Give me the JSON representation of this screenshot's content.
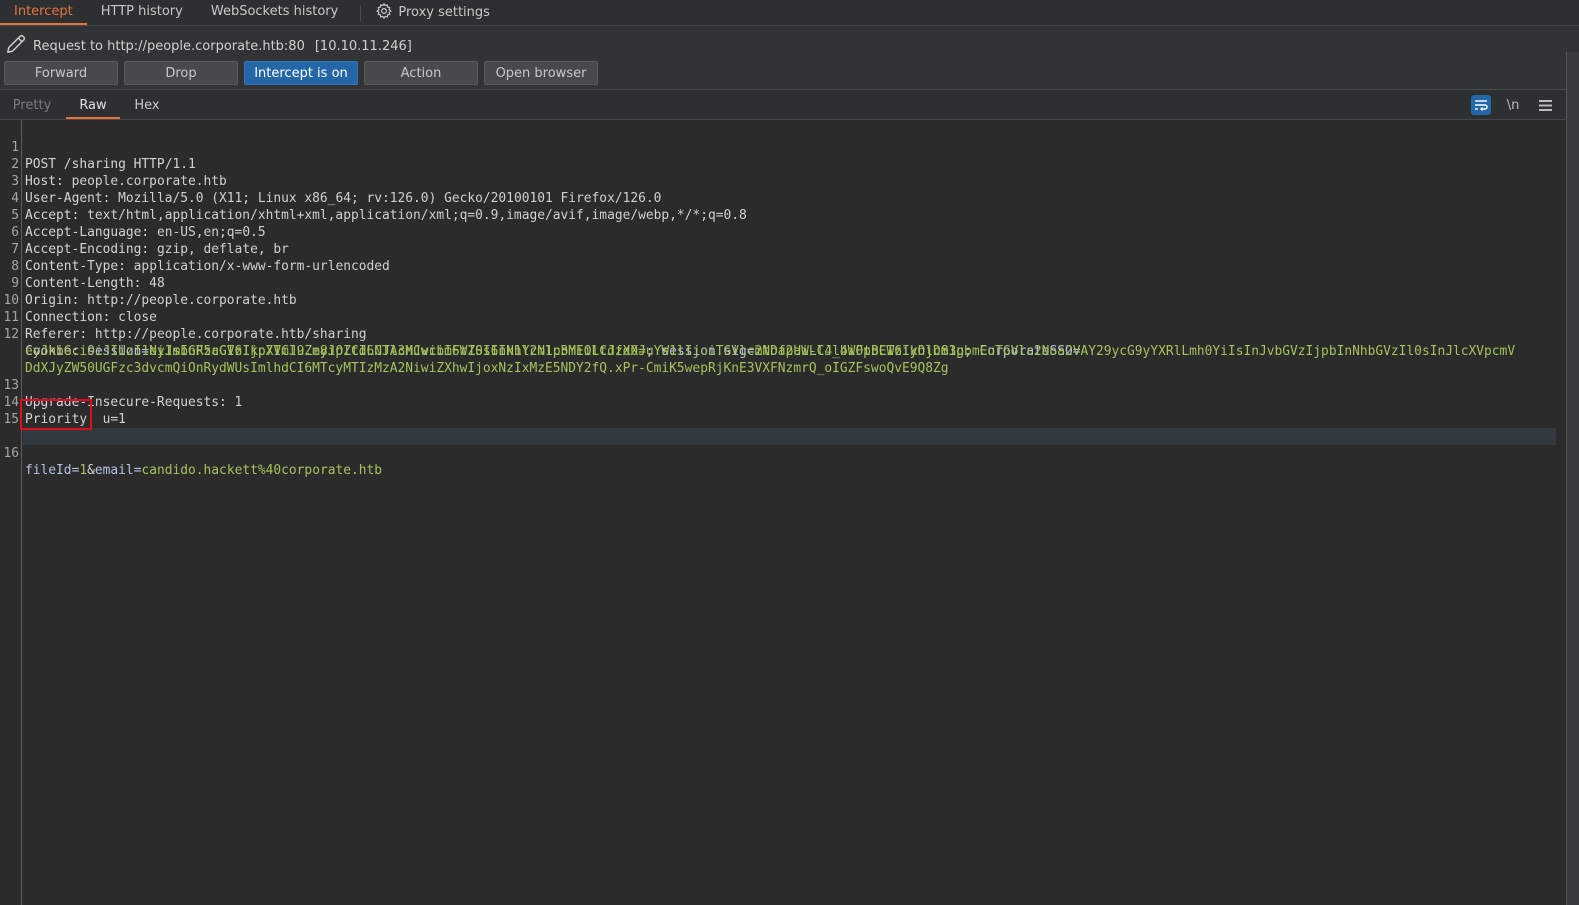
{
  "topnav": {
    "tabs": [
      {
        "label": "Intercept",
        "active": true
      },
      {
        "label": "HTTP history",
        "active": false
      },
      {
        "label": "WebSockets history",
        "active": false
      }
    ],
    "settings_label": "Proxy settings",
    "settings_icon": "gear-icon"
  },
  "request": {
    "icon": "pencil-icon",
    "label": "Request to http://people.corporate.htb:80",
    "ip": "[10.10.11.246]"
  },
  "buttons": {
    "forward": "Forward",
    "drop": "Drop",
    "intercept": "Intercept is on",
    "action": "Action",
    "open_browser": "Open browser"
  },
  "subtabs": {
    "pretty": "Pretty",
    "raw": "Raw",
    "hex": "Hex",
    "active": "Raw"
  },
  "tools": {
    "wrap_icon": "word-wrap-icon",
    "newline_label": "\\n",
    "menu_icon": "hamburger-menu-icon"
  },
  "lines": [
    {
      "n": "1",
      "text": "POST /sharing HTTP/1.1"
    },
    {
      "n": "2",
      "key": "Host:",
      "value": " people.corporate.htb"
    },
    {
      "n": "3",
      "key": "User-Agent:",
      "value": " Mozilla/5.0 (X11; Linux x86_64; rv:126.0) Gecko/20100101 Firefox/126.0"
    },
    {
      "n": "4",
      "key": "Accept:",
      "value": " text/html,application/xhtml+xml,application/xml;q=0.9,image/avif,image/webp,*/*;q=0.8"
    },
    {
      "n": "5",
      "key": "Accept-Language:",
      "value": " en-US,en;q=0.5"
    },
    {
      "n": "6",
      "key": "Accept-Encoding:",
      "value": " gzip, deflate, br"
    },
    {
      "n": "7",
      "key": "Content-Type:",
      "value": " application/x-www-form-urlencoded"
    },
    {
      "n": "8",
      "key": "Content-Length:",
      "value": " 48"
    },
    {
      "n": "9",
      "key": "Origin:",
      "value": " http://people.corporate.htb"
    },
    {
      "n": "10",
      "key": "Connection:",
      "value": " close"
    },
    {
      "n": "11",
      "key": "Referer:",
      "value": " http://people.corporate.htb/sharing"
    },
    {
      "n": "12",
      "key": "Cookie:",
      "cookies": {
        "session_name": "session",
        "session_value": "eyJmbGFzaGVzIjp7ImluZm8iOltdLCJlcnJvciI6W10sInN1Y2Nlc3MiOltdfX0=",
        "sig_name": "session.sig",
        "sig_value": "mtDfpaW-l4_4iOtBEWziyOjD83g",
        "sso_name": "CorporateSSO",
        "sso_line1": "eyJhbGciOiJIUzI1NiIsInR5cCI6IkpXVCJ9.eyJpZCI6NTA3MCwibmFtZSI6Ikhlcm1pbmEiLCJzdXJuYW1lIjoiTGVlc2Noa2UiLCJlbWFpbCI6Ikhlcm1pbmEuTGVlc2Noa2VAY29ycG9yYXRlLmh0YiIsInJvbGVzIjpbInNhbGVzIl0sInJlcXVpcmV",
        "sso_line2": "DdXJyZW50UGFzc3dvcmQiOnRydWUsImlhdCI6MTcyMTIzMzA2NiwiZXhwIjoxNzIxMzE5NDY2fQ.xPr-CmiK5wepRjKnE3VXFNzmrQ_oIGZFswoQvE9Q8Zg"
      }
    },
    {
      "n": "13",
      "key": "Upgrade-Insecure-Requests:",
      "value": " 1"
    },
    {
      "n": "14",
      "key": "Priority:",
      "value": " u=1"
    },
    {
      "n": "15",
      "text": ""
    },
    {
      "n": "16",
      "body": {
        "k1": "fileId",
        "v1": "1",
        "k2": "email",
        "v2": "candido.hackett%40corporate.htb"
      }
    }
  ],
  "colors": {
    "accent": "#e3743c",
    "primary_button": "#2567a6",
    "cookie_value": "#a6c25a",
    "cookie_name": "#b7c0e4",
    "annotation_box": "#e00d1d"
  }
}
